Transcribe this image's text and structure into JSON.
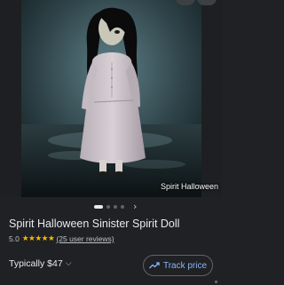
{
  "product": {
    "title": "Spirit Halloween Sinister Spirit Doll",
    "rating": "5.0",
    "stars": "★★★★★",
    "reviews_label": "(25 user reviews)",
    "price_label": "Typically $47",
    "price_chevron": "⌵",
    "image_watermark": "Spirit Halloween"
  },
  "carousel": {
    "next_icon": "›",
    "slide_count": 4,
    "active_index": 0
  },
  "actions": {
    "track_price_label": "Track price",
    "track_icon": "trending-up-icon"
  },
  "colors": {
    "background": "#202124",
    "star": "#fbbc04",
    "link_accent": "#8ab4f8"
  }
}
